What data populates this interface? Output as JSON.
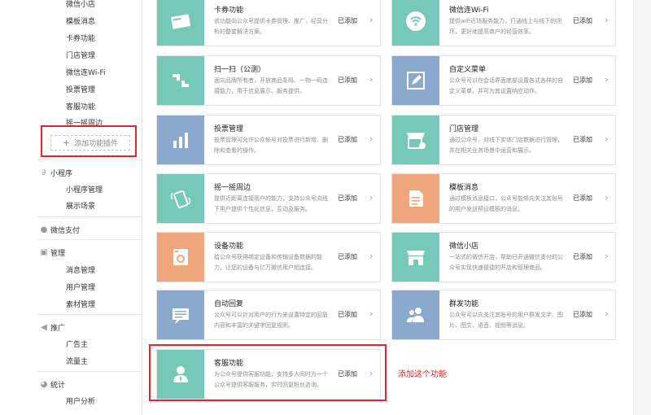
{
  "sidebar": {
    "top_items": [
      "微信小店",
      "模板消息",
      "卡券功能",
      "门店管理",
      "微信连Wi-Fi",
      "投票管理",
      "客服功能",
      "摇一摇周边"
    ],
    "add_plugin_label": "添加功能插件",
    "miniprogram": {
      "title": "小程序",
      "items": [
        "小程序管理",
        "展示场景"
      ]
    },
    "pay": {
      "title": "微信支付"
    },
    "manage": {
      "title": "管理",
      "items": [
        "消息管理",
        "用户管理",
        "素材管理"
      ]
    },
    "promote": {
      "title": "推广",
      "items": [
        "广告主",
        "流量主"
      ]
    },
    "stats": {
      "title": "统计",
      "items": [
        "用户分析"
      ]
    }
  },
  "cards": [
    {
      "title": "卡券功能",
      "desc": "该功能向公众号提供卡券管理、推广、经营分析的整套解决方案。",
      "status": "已添加",
      "icon": "card-icon",
      "color": "#76c8b9"
    },
    {
      "title": "微信连Wi-Fi",
      "desc": "提供wifi近场服务能力，打通线上与线下的闭环，更好地提高商户的经营效率。",
      "status": "已添加",
      "icon": "wifi-icon",
      "color": "#76c8b9"
    },
    {
      "title": "扫一扫（公测）",
      "desc": "面向品牌所有者，开放商品条码、一物一码连接能力，用于信息展示、服务提供。",
      "status": "已添加",
      "icon": "scan-icon",
      "color": "#76c8b9"
    },
    {
      "title": "自定义菜单",
      "desc": "公众号可以在会话界面底部设置各式各样的自定义菜单，并可为其设置响应动作。",
      "status": "已添加",
      "icon": "edit-menu-icon",
      "color": "#8aa9cc"
    },
    {
      "title": "投票管理",
      "desc": "投票管理可允许公众帐号对投票进行新增、删除和查看的操作。",
      "status": "已添加",
      "icon": "bar-chart-icon",
      "color": "#8aa9cc"
    },
    {
      "title": "门店管理",
      "desc": "通过公众号，对线下实体门店数据进行管理，并在相关业务场景中运营和展示。",
      "status": "已添加",
      "icon": "store-gear-icon",
      "color": "#76c8b9"
    },
    {
      "title": "摇一摇周边",
      "desc": "提供近距离连接用户的能力，支持公众号向线下用户提供个性化信息、互动及服务。",
      "status": "已添加",
      "icon": "shake-icon",
      "color": "#76c8b9"
    },
    {
      "title": "模板消息",
      "desc": "通过模板消息接口，公众号能够向关注其账号的用户发送预设模板的消息。",
      "status": "已添加",
      "icon": "template-doc-icon",
      "color": "#f0a67c"
    },
    {
      "title": "设备功能",
      "desc": "给公众号获得绑定设备和传输设备数据的能力，让您的设备与亿万微信用户相连接。",
      "status": "已添加",
      "icon": "washer-icon",
      "color": "#f0a67c"
    },
    {
      "title": "微信小店",
      "desc": "一站式的微信开店，帮助已开通微信支付的公众号实现快速便捷的开店和管理商品。",
      "status": "已添加",
      "icon": "shop-icon",
      "color": "#76c8b9"
    },
    {
      "title": "自动回复",
      "desc": "公众号可以针对用户的行为来设置特定的回复内容和丰富的关键字回复规则。",
      "status": "已添加",
      "icon": "message-icon",
      "color": "#8aa9cc"
    },
    {
      "title": "群发功能",
      "desc": "公众号可以向关注其账号的用户群发文字、图片、图文、语音、视频等消息。",
      "status": "已添加",
      "icon": "group-users-icon",
      "color": "#8aa9cc"
    },
    {
      "title": "客服功能",
      "desc": "为公众号提供客服功能，支持多人同时为一个公众号提供客服服务，实时回复粉丝咨询。",
      "status": "已添加",
      "icon": "customer-service-icon",
      "color": "#76c8b9"
    }
  ],
  "annotation": "添加这个功能",
  "colors": {
    "highlight": "#e0262f",
    "teal": "#76c8b9",
    "blue": "#8aa9cc",
    "orange": "#f0a67c"
  }
}
